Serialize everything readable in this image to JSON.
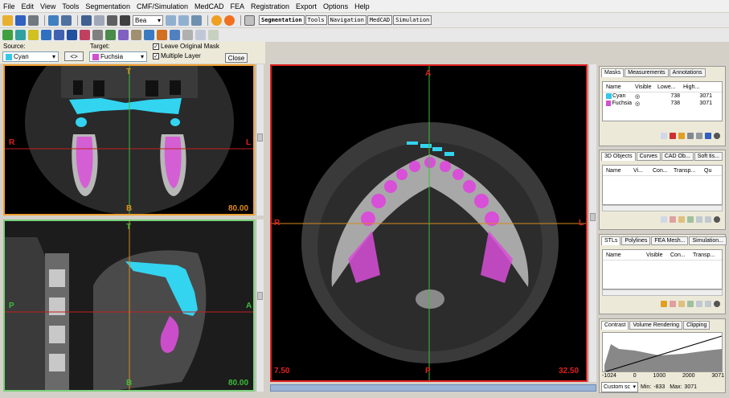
{
  "menu": [
    "File",
    "Edit",
    "View",
    "Tools",
    "Segmentation",
    "CMF/Simulation",
    "MedCAD",
    "FEA",
    "Registration",
    "Export",
    "Options",
    "Help"
  ],
  "toolbar": {
    "zoom_combo": "Bea",
    "mode_tabs": [
      "Segmentation",
      "Tools",
      "Navigation",
      "MedCAD",
      "Simulation"
    ]
  },
  "segmentation": {
    "source_label": "Source:",
    "source_value": "Cyan",
    "swap_label": "<>",
    "target_label": "Target:",
    "target_value": "Fuchsia",
    "leave_original_label": "Leave Original Mask",
    "multiple_layer_label": "Multiple Layer",
    "close_label": "Close"
  },
  "views": {
    "coronal": {
      "top": "T",
      "bottom": "B",
      "left": "R",
      "right": "L",
      "value": "80.00"
    },
    "sagittal": {
      "top": "T",
      "bottom": "B",
      "left": "P",
      "right": "A",
      "value": "80.00"
    },
    "axial": {
      "top": "A",
      "bottom": "P",
      "left": "R",
      "right": "L",
      "value_left": "7.50",
      "value_right": "32.50"
    }
  },
  "masks_panel": {
    "tabs": [
      "Masks",
      "Measurements",
      "Annotations"
    ],
    "columns": [
      "Name",
      "Visible",
      "Lowe...",
      "High..."
    ],
    "rows": [
      {
        "name": "Cyan",
        "color": "#33c8e8",
        "low": "738",
        "high": "3071"
      },
      {
        "name": "Fuchsia",
        "color": "#d050d0",
        "low": "738",
        "high": "3071"
      }
    ]
  },
  "objects_panel": {
    "tabs": [
      "3D Objects",
      "Curves",
      "CAD Ob...",
      "Soft tis..."
    ],
    "columns": [
      "Name",
      "Vi...",
      "Con...",
      "Transp...",
      "Qu"
    ]
  },
  "stl_panel": {
    "tabs": [
      "STLs",
      "Polylines",
      "FEA Mesh...",
      "Simulation..."
    ],
    "columns": [
      "Name",
      "Visible",
      "Con...",
      "Transp..."
    ]
  },
  "contrast_panel": {
    "tabs": [
      "Contrast",
      "Volume Rendering",
      "Clipping"
    ],
    "axis_ticks": [
      "-1024",
      "0",
      "1000",
      "2000",
      "3071"
    ],
    "preset": "Custom sc",
    "min_label": "Min:",
    "min_value": "-833",
    "max_label": "Max:",
    "max_value": "3071"
  },
  "colors": {
    "cyan_mask": "#33d4f0",
    "fuchsia_mask": "#d84fd8",
    "coronal_border": "#f0a030",
    "sagittal_border": "#7ad07a",
    "axial_border": "#e02020",
    "crosshair_orange": "#d88a1a",
    "crosshair_red": "#c02020",
    "crosshair_green": "#3bbd3b"
  }
}
